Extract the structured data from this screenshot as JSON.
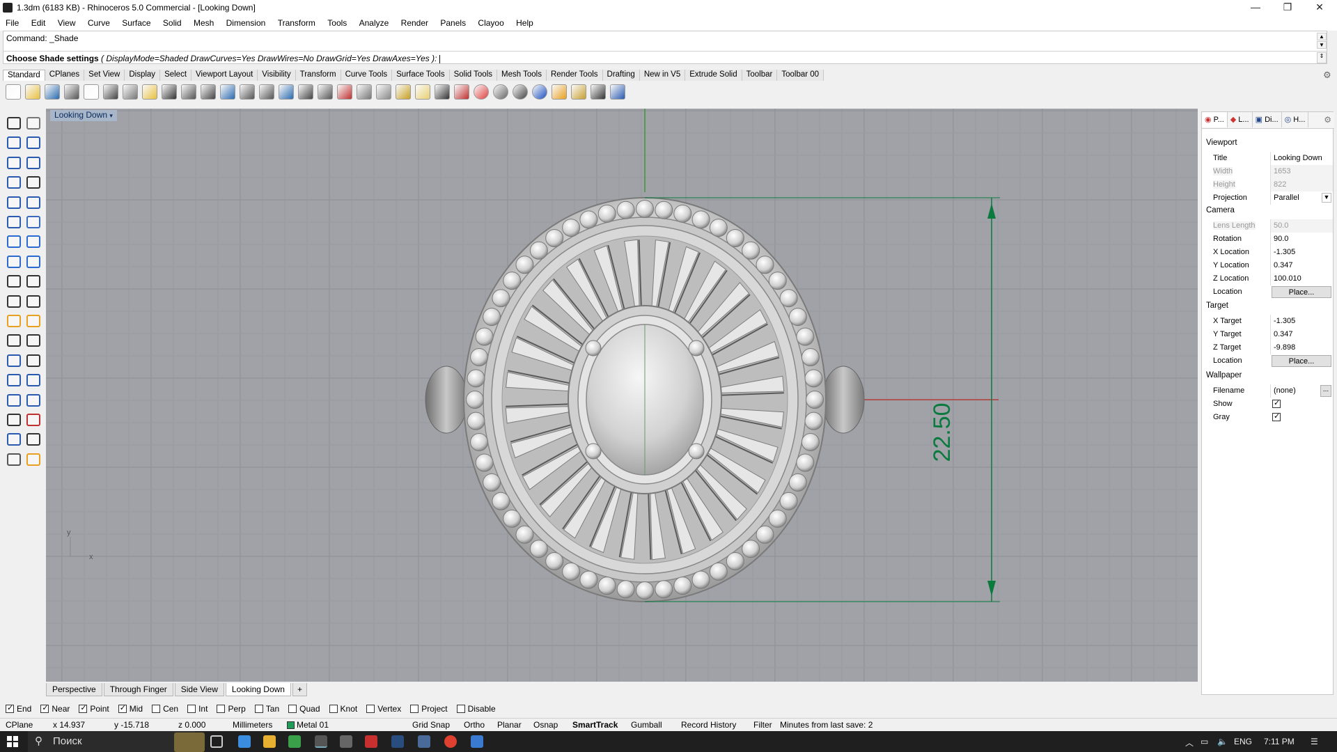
{
  "window": {
    "title": "1.3dm (6183 KB) - Rhinoceros 5.0 Commercial - [Looking Down]",
    "controls": {
      "minimize": "—",
      "maximize": "❐",
      "close": "✕"
    }
  },
  "menu": [
    "File",
    "Edit",
    "View",
    "Curve",
    "Surface",
    "Solid",
    "Mesh",
    "Dimension",
    "Transform",
    "Tools",
    "Analyze",
    "Render",
    "Panels",
    "Clayoo",
    "Help"
  ],
  "command": {
    "history": "Command: _Shade",
    "prompt_bold": "Choose Shade settings",
    "prompt_options": "( DisplayMode=Shaded  DrawCurves=Yes  DrawWires=No  DrawGrid=Yes  DrawAxes=Yes ):"
  },
  "toolbar_tabs": [
    "Standard",
    "CPlanes",
    "Set View",
    "Display",
    "Select",
    "Viewport Layout",
    "Visibility",
    "Transform",
    "Curve Tools",
    "Surface Tools",
    "Solid Tools",
    "Mesh Tools",
    "Render Tools",
    "Drafting",
    "New in V5",
    "Extrude Solid",
    "Toolbar",
    "Toolbar 00"
  ],
  "standard_icons": [
    "new-file-icon",
    "open-file-icon",
    "save-icon",
    "print-icon",
    "import-icon",
    "cut-icon",
    "copy-icon",
    "paste-icon",
    "undo-icon",
    "pan-icon",
    "rotate-view-icon",
    "zoom-in-icon",
    "zoom-window-icon",
    "zoom-extents-icon",
    "zoom-selected-icon",
    "zoom-refresh-icon",
    "four-viewports-icon",
    "car-icon",
    "camera-icon",
    "circle-icon",
    "snap-icon",
    "light-icon",
    "lock-icon",
    "material-icon",
    "color-wheel-icon",
    "shaded-sphere-icon",
    "rendered-sphere-icon",
    "blue-sphere-icon",
    "flag-icon",
    "gear-icon",
    "dimension-icon",
    "help-icon"
  ],
  "colors": {
    "viewport_bg": "#a0a2a8",
    "dimension": "#0b7a3e",
    "x_axis": "#b43c3c",
    "y_axis": "#3a9a3a",
    "ring_light": "#e8e8e8",
    "ring_mid": "#c4c4c4",
    "ring_dark": "#8c8c8c"
  },
  "viewport": {
    "title": "Looking Down",
    "dimension_label": "22.50",
    "axis_y": "y",
    "axis_x": "x"
  },
  "viewport_tabs": [
    "Perspective",
    "Through Finger",
    "Side View",
    "Looking Down"
  ],
  "viewport_tab_add": "+",
  "osnaps": [
    {
      "label": "End",
      "checked": true
    },
    {
      "label": "Near",
      "checked": true
    },
    {
      "label": "Point",
      "checked": true
    },
    {
      "label": "Mid",
      "checked": true
    },
    {
      "label": "Cen",
      "checked": false
    },
    {
      "label": "Int",
      "checked": false
    },
    {
      "label": "Perp",
      "checked": false
    },
    {
      "label": "Tan",
      "checked": false
    },
    {
      "label": "Quad",
      "checked": false
    },
    {
      "label": "Knot",
      "checked": false
    },
    {
      "label": "Vertex",
      "checked": false
    },
    {
      "label": "Project",
      "checked": false
    },
    {
      "label": "Disable",
      "checked": false
    }
  ],
  "status": {
    "cplane": "CPlane",
    "x": "x 14.937",
    "y": "y -15.718",
    "z": "z 0.000",
    "units": "Millimeters",
    "layer": "Metal 01",
    "layer_color": "#1f9c5a",
    "toggles": [
      "Grid Snap",
      "Ortho",
      "Planar",
      "Osnap",
      "SmartTrack",
      "Gumball",
      "Record History",
      "Filter"
    ],
    "save_info": "Minutes from last save: 2"
  },
  "panel": {
    "tabs": [
      "P...",
      "L...",
      "Di...",
      "H..."
    ],
    "viewport_header": "Viewport",
    "camera_header": "Camera",
    "target_header": "Target",
    "wallpaper_header": "Wallpaper",
    "rows": {
      "title": {
        "label": "Title",
        "value": "Looking Down"
      },
      "width": {
        "label": "Width",
        "value": "1653"
      },
      "height": {
        "label": "Height",
        "value": "822"
      },
      "projection": {
        "label": "Projection",
        "value": "Parallel"
      },
      "lens": {
        "label": "Lens Length",
        "value": "50.0"
      },
      "rotation": {
        "label": "Rotation",
        "value": "90.0"
      },
      "xloc": {
        "label": "X Location",
        "value": "-1.305"
      },
      "yloc": {
        "label": "Y Location",
        "value": "0.347"
      },
      "zloc": {
        "label": "Z Location",
        "value": "100.010"
      },
      "camloc": {
        "label": "Location",
        "value": "Place..."
      },
      "xtgt": {
        "label": "X Target",
        "value": "-1.305"
      },
      "ytgt": {
        "label": "Y Target",
        "value": "0.347"
      },
      "ztgt": {
        "label": "Z Target",
        "value": "-9.898"
      },
      "tgtloc": {
        "label": "Location",
        "value": "Place..."
      },
      "filename": {
        "label": "Filename",
        "value": "(none)"
      },
      "filename_btn": "...",
      "show": {
        "label": "Show",
        "checked": true
      },
      "gray": {
        "label": "Gray",
        "checked": true
      }
    }
  },
  "taskbar": {
    "search_placeholder": "Поиск",
    "lang": "ENG",
    "time": "7:11 PM"
  }
}
